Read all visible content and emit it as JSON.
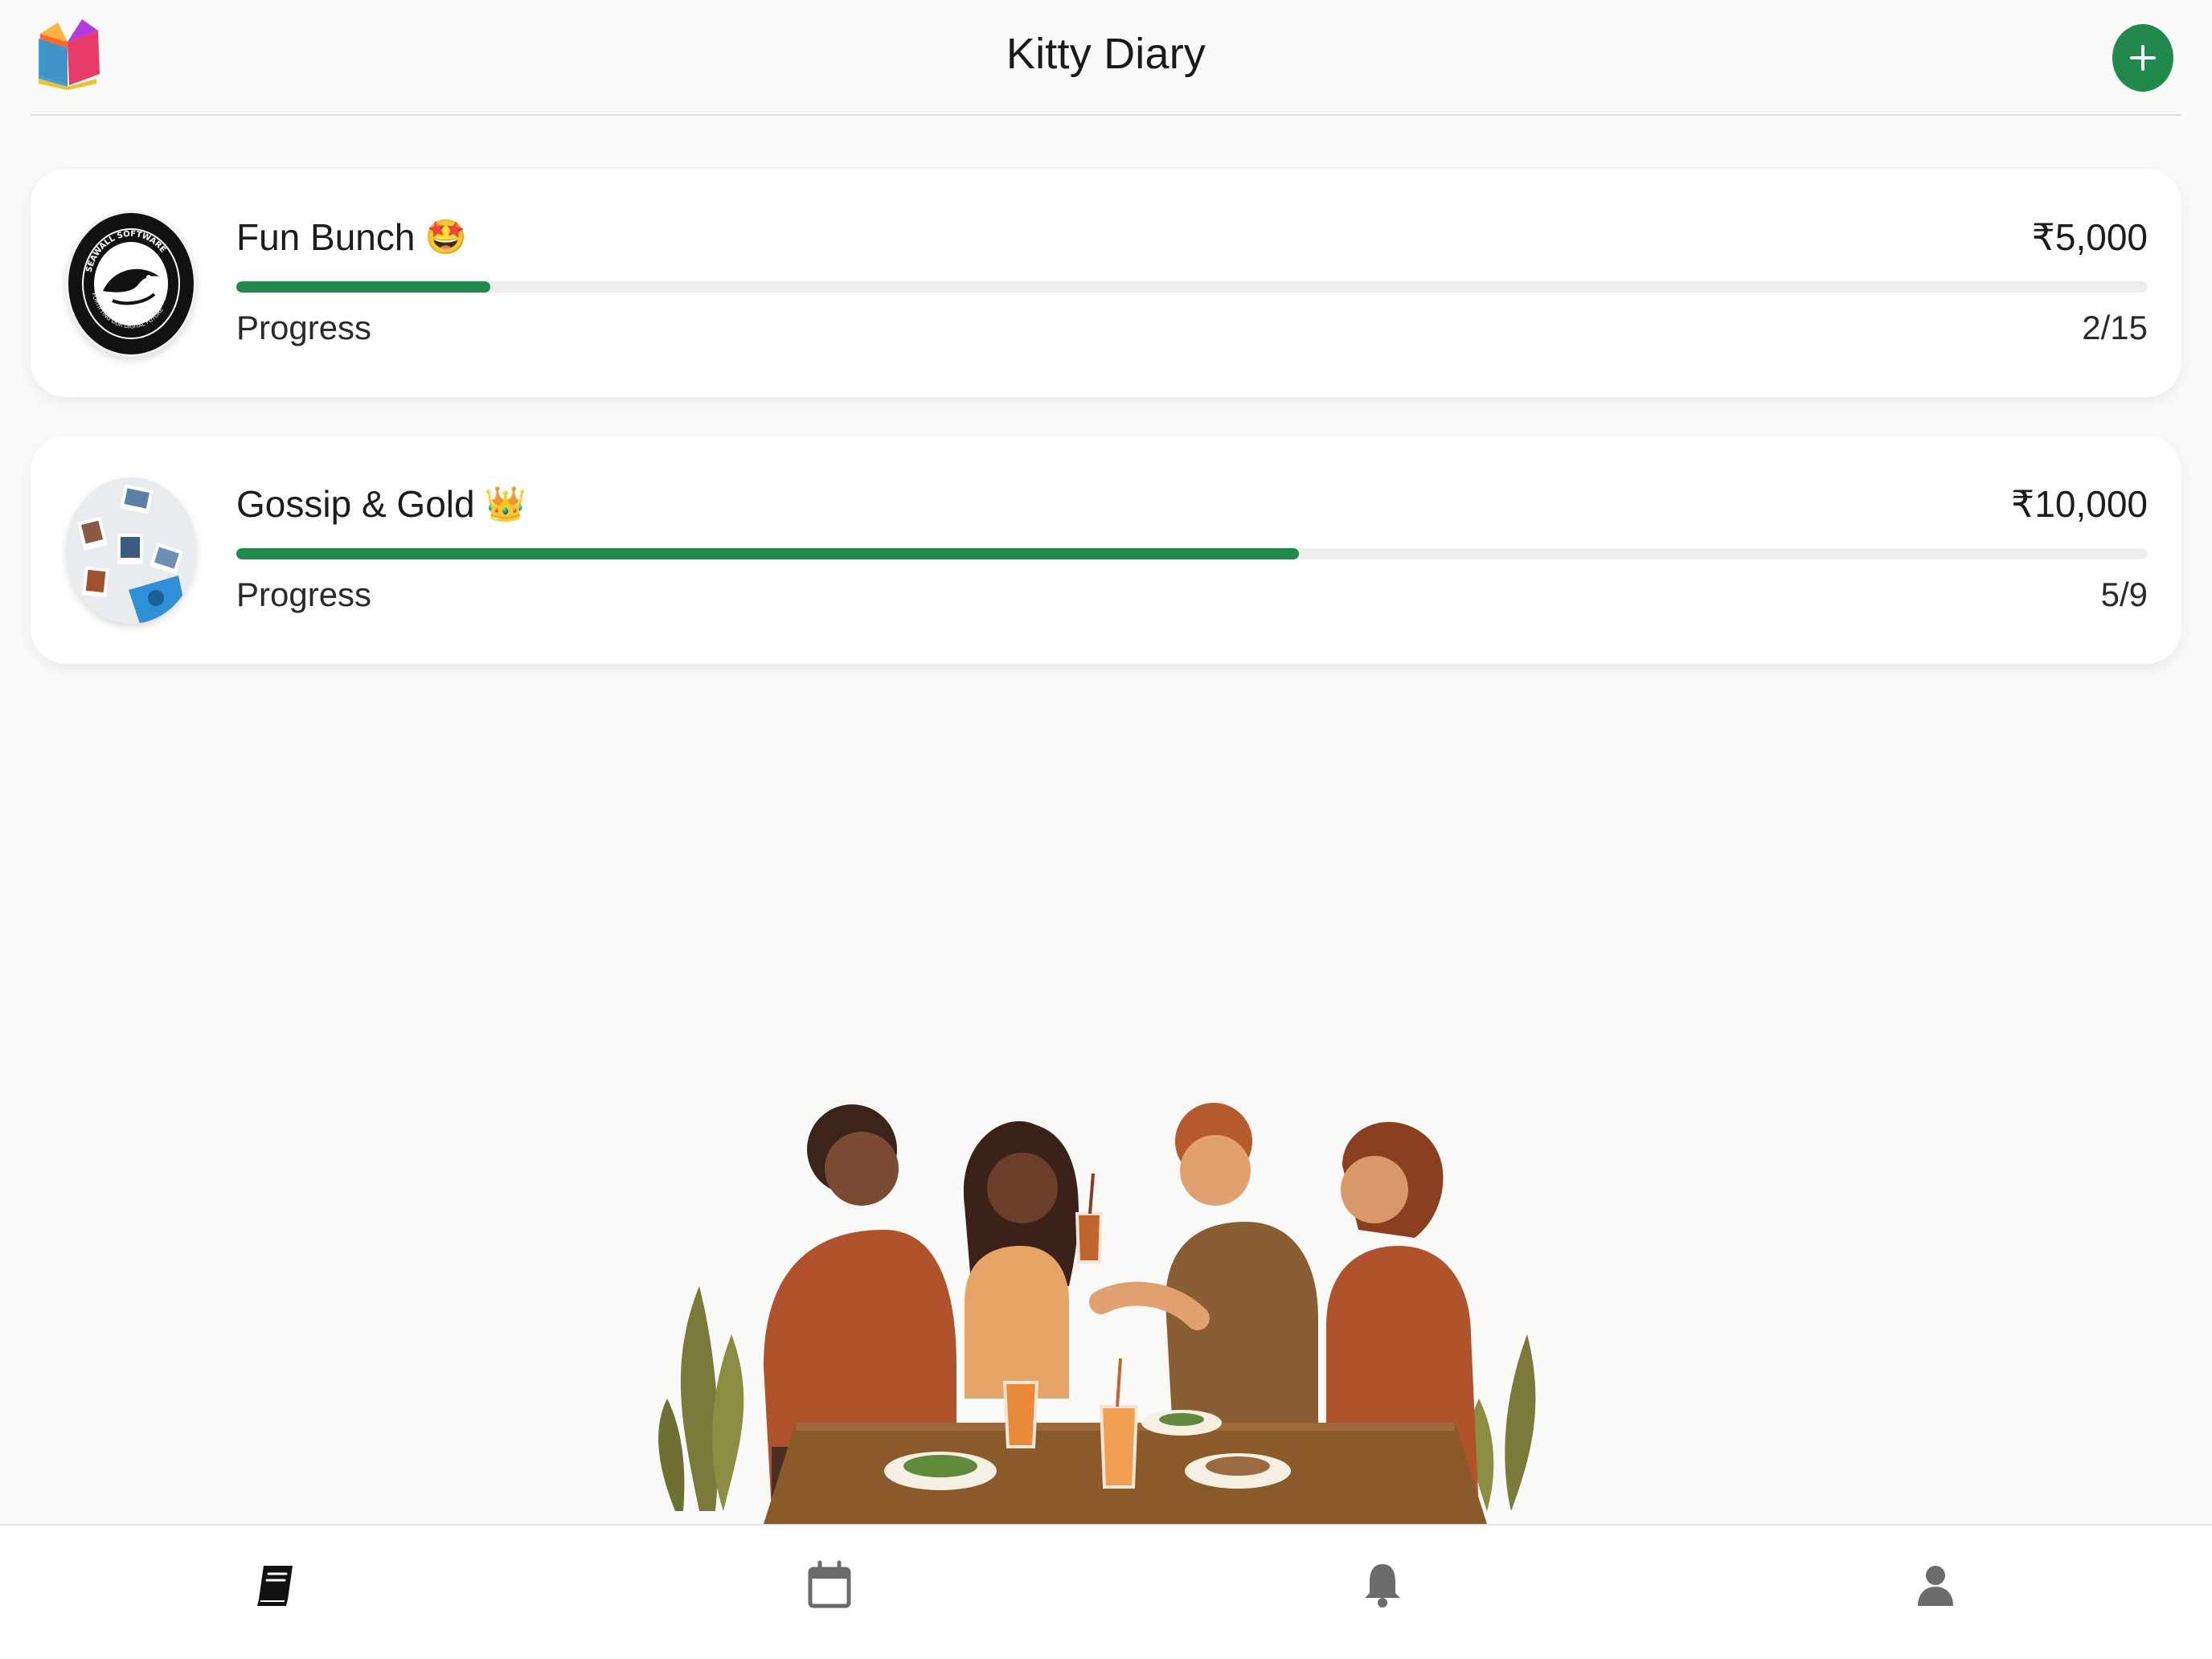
{
  "header": {
    "title": "Kitty Diary",
    "logo_icon": "open-book-logo-icon",
    "add_icon": "plus-icon"
  },
  "groups": [
    {
      "name": "Fun Bunch",
      "emoji": "🤩",
      "amount": "₹5,000",
      "progress_label": "Progress",
      "progress_text": "2/15",
      "progress_fraction": 0.133,
      "avatar": "seawall-badge-avatar",
      "avatar_text": "SEAWALL SOFTWARE · FORTIFYING OUR DIGITAL FUTURE"
    },
    {
      "name": "Gossip & Gold",
      "emoji": "👑",
      "amount": "₹10,000",
      "progress_label": "Progress",
      "progress_text": "5/9",
      "progress_fraction": 0.556,
      "avatar": "photo-collage-avatar"
    }
  ],
  "illustration": "friends-dining-illustration",
  "bottom_nav": {
    "items": [
      "diary-icon",
      "calendar-icon",
      "bell-icon",
      "profile-icon"
    ],
    "active": "diary-icon"
  },
  "colors": {
    "accent": "#1f8a4c",
    "background": "#fafaf8",
    "card": "#ffffff",
    "track": "#ededed"
  }
}
